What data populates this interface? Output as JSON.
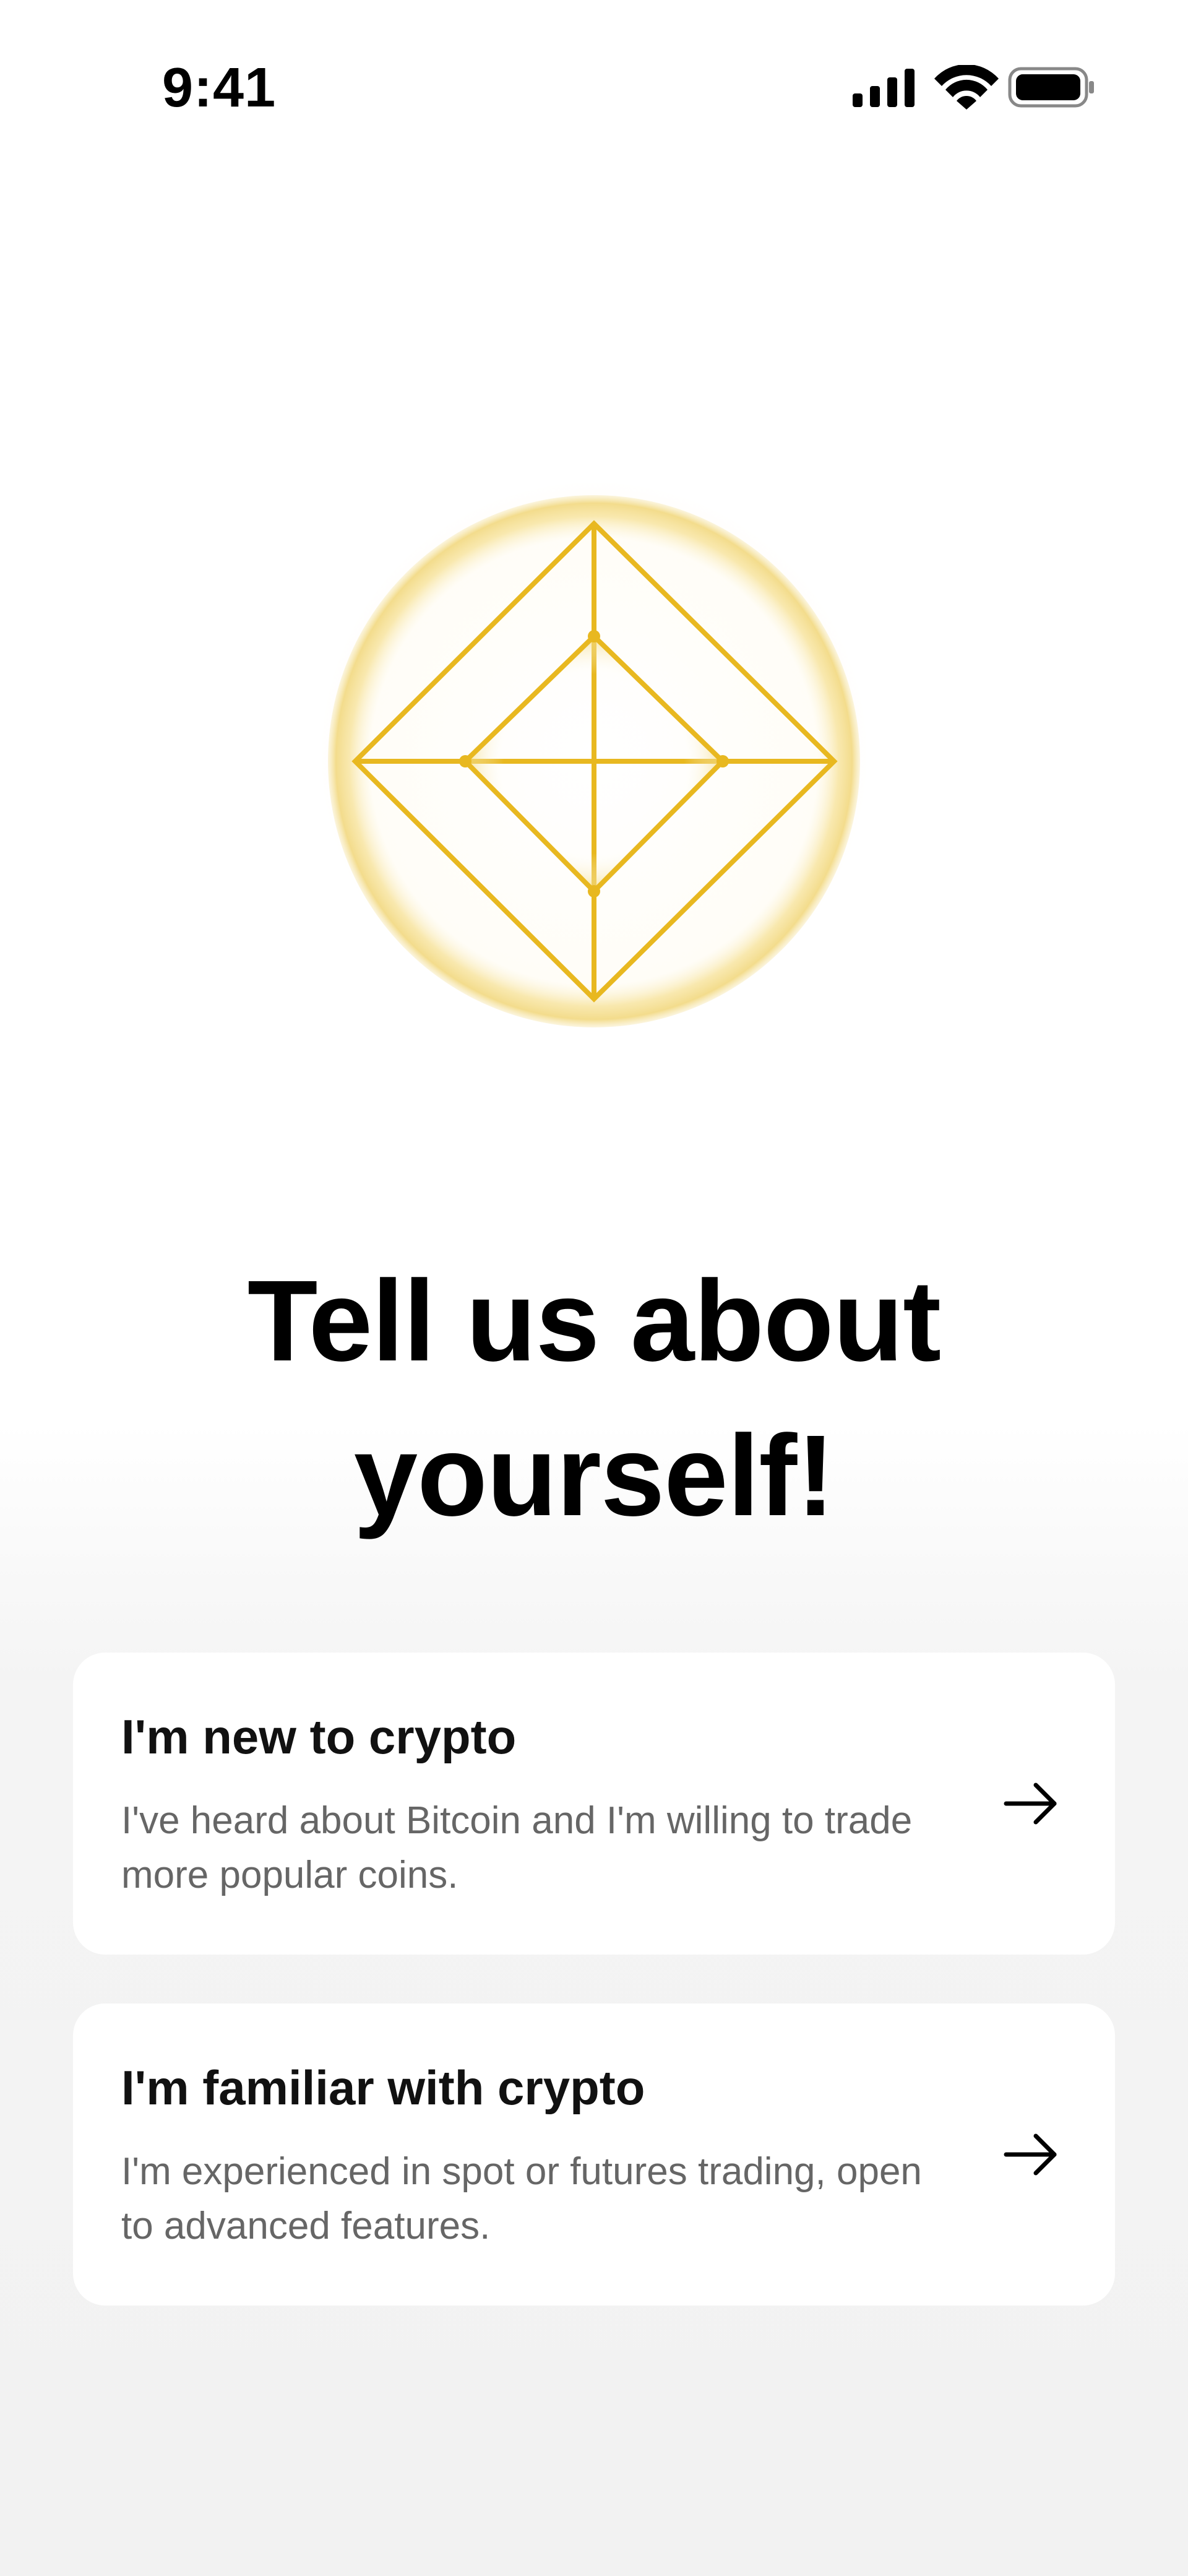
{
  "status_bar": {
    "time": "9:41",
    "icons": [
      "cellular-signal-icon",
      "wifi-icon",
      "battery-icon"
    ]
  },
  "hero": {
    "icon": "diamond-emblem-icon",
    "accent_color": "#E8B820"
  },
  "headline": "Tell us about\nyourself!",
  "options": [
    {
      "title": "I'm new to crypto",
      "description": "I've heard about Bitcoin and I'm willing to trade more popular coins.",
      "icon": "arrow-right-icon"
    },
    {
      "title": "I'm familiar with crypto",
      "description": "I'm experienced in spot or futures trading, open to advanced features.",
      "icon": "arrow-right-icon"
    }
  ]
}
